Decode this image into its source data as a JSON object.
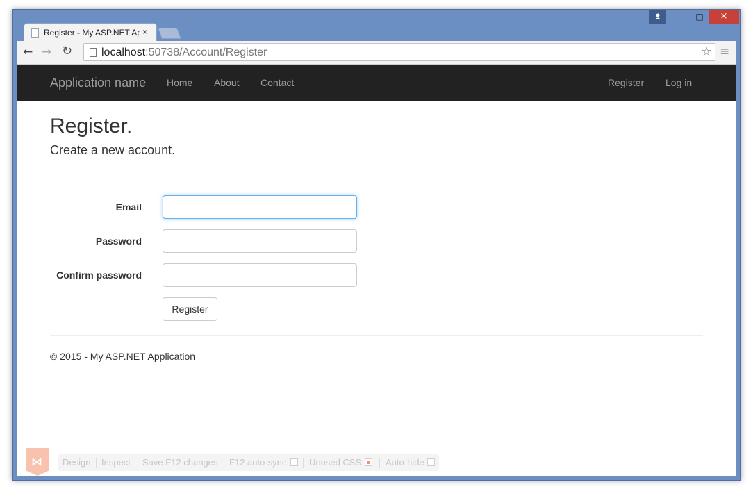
{
  "browser": {
    "tab_title": "Register - My ASP.NET Ap",
    "tab_close": "×",
    "url_host": "localhost",
    "url_rest": ":50738/Account/Register",
    "window_controls": {
      "minimize": "–",
      "maximize": "□",
      "close": "×"
    },
    "icons": {
      "back": "←",
      "forward": "→",
      "reload": "↻",
      "star": "☆",
      "menu": "≡"
    }
  },
  "navbar": {
    "brand": "Application name",
    "links": [
      "Home",
      "About",
      "Contact"
    ],
    "right_links": [
      "Register",
      "Log in"
    ]
  },
  "page": {
    "title": "Register.",
    "subtitle": "Create a new account."
  },
  "form": {
    "email_label": "Email",
    "email_value": "",
    "password_label": "Password",
    "password_value": "",
    "confirm_label": "Confirm password",
    "confirm_value": "",
    "submit_label": "Register"
  },
  "footer": {
    "text": "© 2015 - My ASP.NET Application"
  },
  "vs_bar": {
    "items": [
      "Design",
      "Inspect",
      "Save F12 changes",
      "F12 auto-sync",
      "Unused CSS",
      "Auto-hide"
    ],
    "f12_autosync_checked": false,
    "unused_css_checked": true,
    "autohide_checked": false
  },
  "colors": {
    "navbar_bg": "#222222",
    "window_frame": "#6b8fc2",
    "focus_border": "#66afe9",
    "close_button": "#c7413a"
  }
}
